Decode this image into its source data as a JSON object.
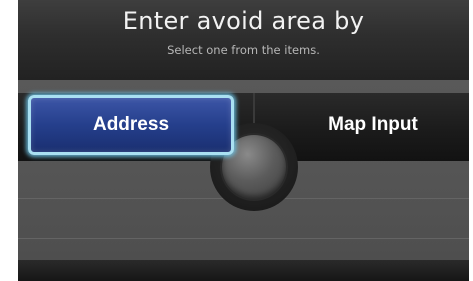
{
  "header": {
    "title": "Enter avoid area by",
    "subtitle": "Select one from the items."
  },
  "options": [
    {
      "label": "Address",
      "selected": true
    },
    {
      "label": "Map Input",
      "selected": false
    }
  ],
  "colors": {
    "selected_fill": "#253f8c",
    "selected_outline": "#a9e0f2",
    "panel": "#555555",
    "header": "#2e2e2e"
  },
  "icons": {
    "center_control": "joystick-knob-icon"
  }
}
